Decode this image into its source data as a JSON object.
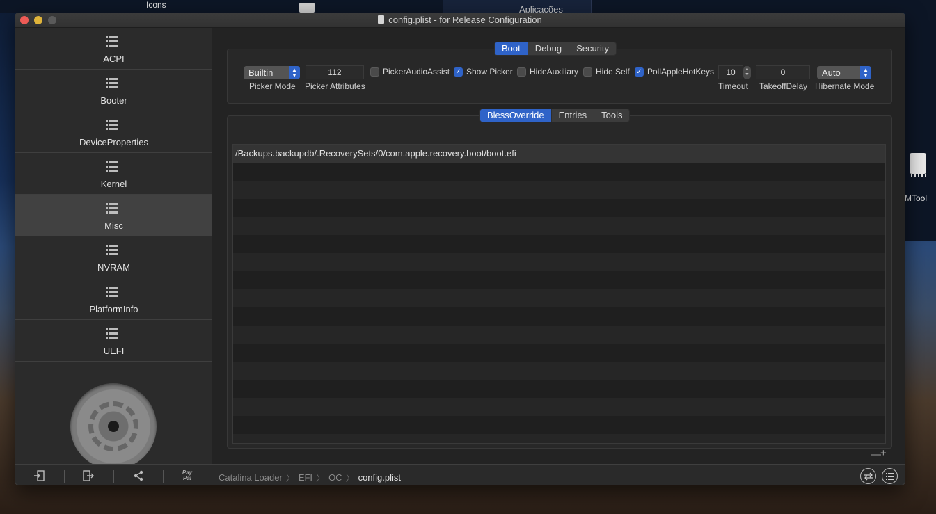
{
  "desktop": {
    "icons_label": "Icons",
    "app_label": "Aplicações",
    "chip_label": "MTool"
  },
  "window": {
    "title": "config.plist - for Release Configuration"
  },
  "sidebar": {
    "items": [
      {
        "label": "ACPI"
      },
      {
        "label": "Booter"
      },
      {
        "label": "DeviceProperties"
      },
      {
        "label": "Kernel"
      },
      {
        "label": "Misc",
        "active": true
      },
      {
        "label": "NVRAM"
      },
      {
        "label": "PlatformInfo"
      },
      {
        "label": "UEFI"
      }
    ],
    "footer": {
      "paypal_line1": "Pay",
      "paypal_line2": "Pal"
    }
  },
  "top_tabs": [
    "Boot",
    "Debug",
    "Security"
  ],
  "boot": {
    "picker_mode": {
      "value": "Builtin",
      "label": "Picker Mode"
    },
    "picker_attributes": {
      "value": "112",
      "label": "Picker Attributes"
    },
    "picker_audio_assist": {
      "label": "PickerAudioAssist",
      "checked": false
    },
    "show_picker": {
      "label": "Show Picker",
      "checked": true
    },
    "hide_auxiliary": {
      "label": "HideAuxiliary",
      "checked": false
    },
    "hide_self": {
      "label": "Hide Self",
      "checked": false
    },
    "poll_apple_hotkeys": {
      "label": "PollAppleHotKeys",
      "checked": true
    },
    "timeout": {
      "value": "10",
      "label": "Timeout"
    },
    "takeoff_delay": {
      "value": "0",
      "label": "TakeoffDelay"
    },
    "hibernate_mode": {
      "value": "Auto",
      "label": "Hibernate Mode"
    }
  },
  "sub_tabs": [
    "BlessOverride",
    "Entries",
    "Tools"
  ],
  "bless_override": {
    "rows": [
      "/Backups.backupdb/.RecoverySets/0/com.apple.recovery.boot/boot.efi"
    ]
  },
  "controls": {
    "minus": "—",
    "plus": "+"
  },
  "breadcrumb": [
    "Catalina Loader",
    "EFI",
    "OC",
    "config.plist"
  ]
}
